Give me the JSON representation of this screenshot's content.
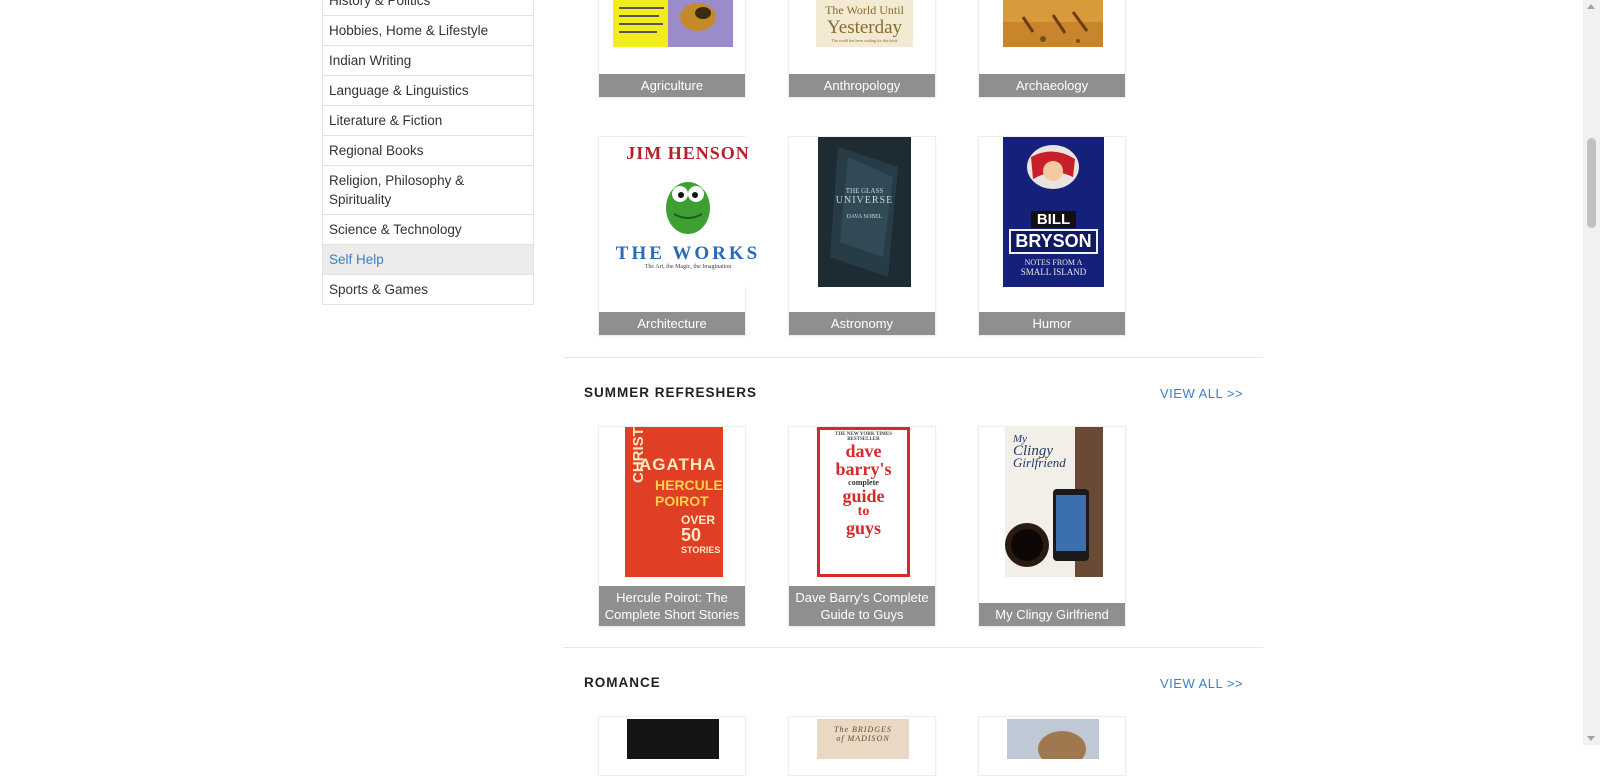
{
  "sidebar": {
    "items": [
      {
        "label": "History & Politics"
      },
      {
        "label": "Hobbies, Home & Lifestyle"
      },
      {
        "label": "Indian Writing"
      },
      {
        "label": "Language & Linguistics"
      },
      {
        "label": "Literature & Fiction"
      },
      {
        "label": "Regional Books"
      },
      {
        "label": "Religion, Philosophy & Spirituality"
      },
      {
        "label": "Science & Technology"
      },
      {
        "label": "Self Help"
      },
      {
        "label": "Sports & Games"
      }
    ]
  },
  "categories": {
    "row1": [
      {
        "label": "Agriculture"
      },
      {
        "label": "Anthropology",
        "cover_text": [
          "The World Until",
          "Yesterday",
          "The world has been waiting for this book"
        ]
      },
      {
        "label": "Archaeology"
      }
    ],
    "row2": [
      {
        "label": "Architecture",
        "cover_text": [
          "JIM HENSON",
          "THE WORKS",
          "The Art, the Magic, the Imagination"
        ]
      },
      {
        "label": "Astronomy",
        "cover_text": [
          "THE GLASS",
          "UNIVERSE",
          "DAVA SOBEL"
        ]
      },
      {
        "label": "Humor",
        "cover_text": [
          "BILL",
          "BRYSON",
          "NOTES FROM A",
          "SMALL ISLAND"
        ]
      }
    ]
  },
  "sections": [
    {
      "title": "SUMMER REFRESHERS",
      "view_all": "VIEW ALL >>",
      "books": [
        {
          "label": "Hercule Poirot: The Complete Short Stories",
          "cover_text": [
            "AGATHA",
            "CHRISTIE",
            "HERCULE",
            "POIROT",
            "OVER",
            "50",
            "STORIES"
          ]
        },
        {
          "label": "Dave Barry's Complete Guide to Guys",
          "cover_text": [
            "THE NEW YORK TIMES BESTSELLER",
            "dave",
            "barry's",
            "complete",
            "guide",
            "to",
            "guys"
          ]
        },
        {
          "label": "My Clingy Girlfriend",
          "cover_text": [
            "My",
            "Clingy",
            "Girlfriend"
          ]
        }
      ]
    },
    {
      "title": "ROMANCE",
      "view_all": "VIEW ALL >>",
      "books": [
        {
          "cover_text": []
        },
        {
          "cover_text": [
            "The BRIDGES",
            "of MADISON"
          ]
        },
        {
          "cover_text": []
        }
      ]
    }
  ],
  "colors": {
    "link": "#3d7fc4",
    "label_bg": "#8f8f8f",
    "active_bg": "#ececec"
  }
}
